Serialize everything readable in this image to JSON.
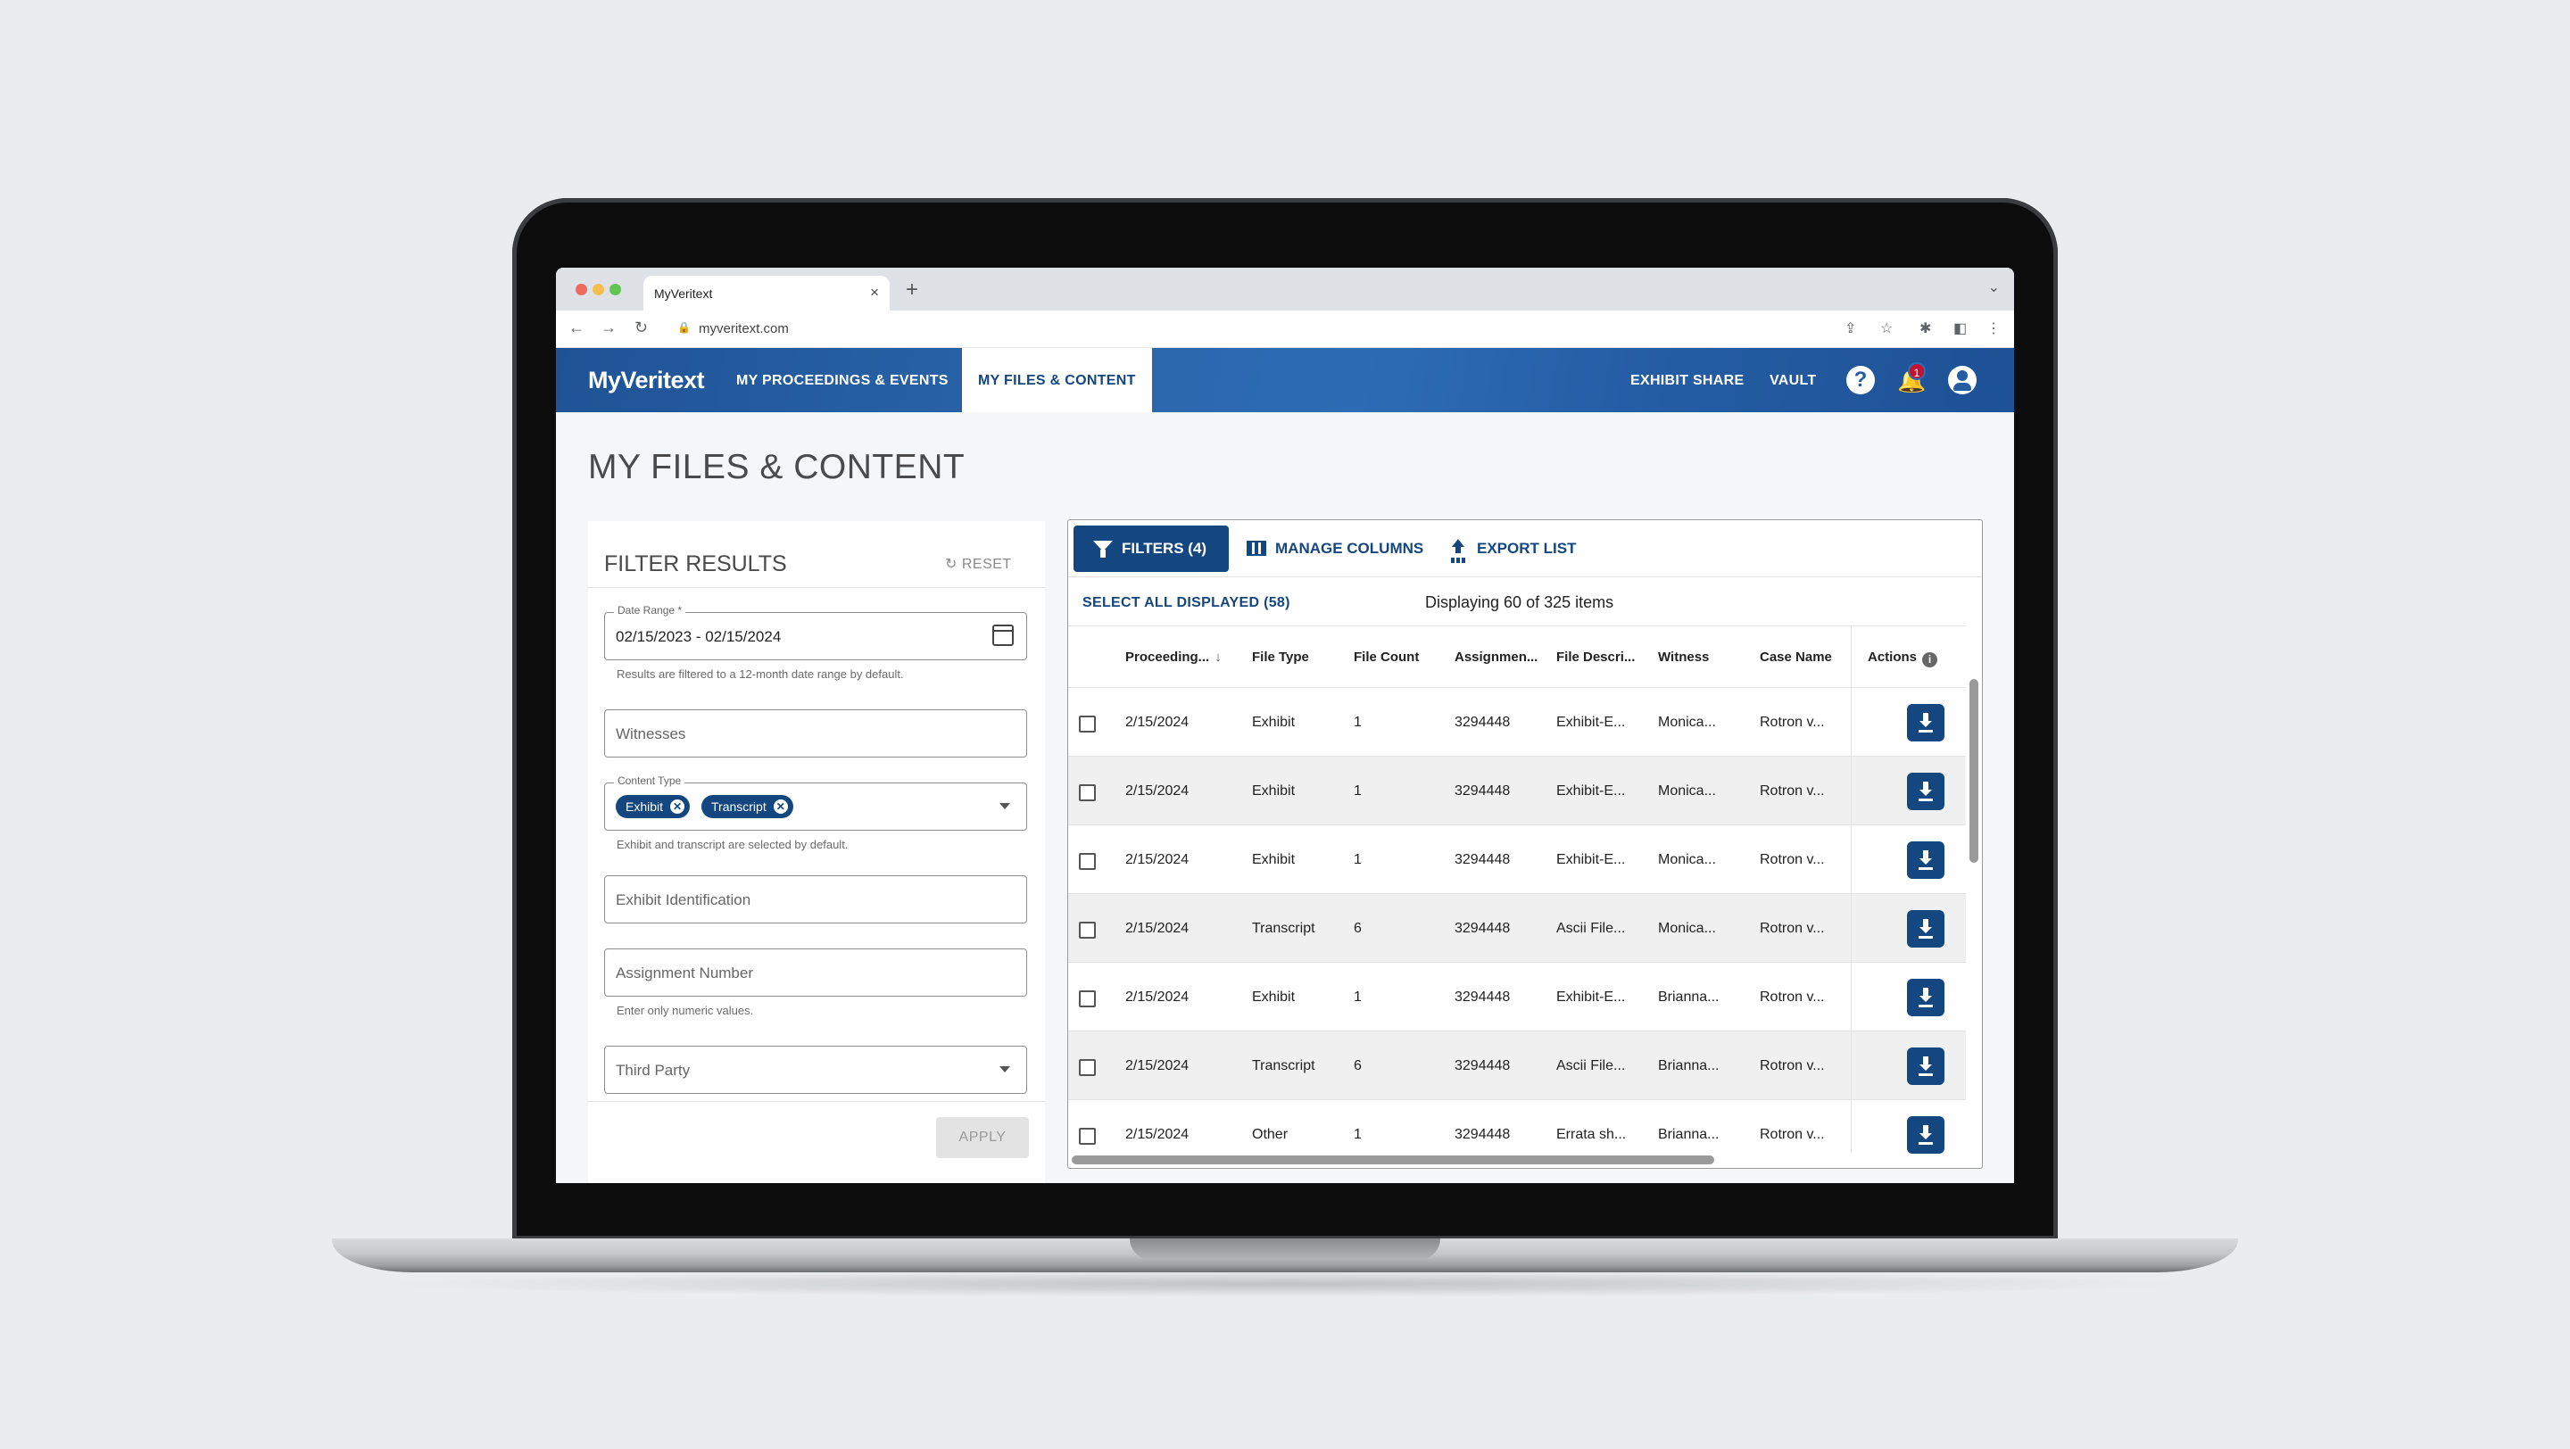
{
  "browser": {
    "tab_title": "MyVeritext",
    "tab_close": "×",
    "new_tab": "+",
    "url": "myveritext.com"
  },
  "header": {
    "brand": "MyVeritext",
    "nav": [
      "MY PROCEEDINGS & EVENTS",
      "MY FILES & CONTENT"
    ],
    "active_nav": "MY FILES & CONTENT",
    "right_links": [
      "EXHIBIT SHARE",
      "VAULT"
    ],
    "help": "?",
    "notification_count": "1"
  },
  "page": {
    "title": "MY FILES & CONTENT"
  },
  "filters": {
    "title": "FILTER RESULTS",
    "reset": "RESET",
    "date_range": {
      "label": "Date Range",
      "required_mark": "*",
      "value": "02/15/2023 - 02/15/2024",
      "help": "Results are filtered to a 12-month date range by default."
    },
    "witnesses": {
      "placeholder": "Witnesses"
    },
    "content_type": {
      "label": "Content Type",
      "chips": [
        "Exhibit",
        "Transcript"
      ],
      "chip_remove": "⊗",
      "help": "Exhibit and transcript are selected by default."
    },
    "exhibit_identification": {
      "placeholder": "Exhibit Identification"
    },
    "assignment_number": {
      "placeholder": "Assignment Number",
      "help": "Enter only numeric values."
    },
    "third_party": {
      "placeholder": "Third Party"
    },
    "apply": "APPLY"
  },
  "results": {
    "filters_button": "FILTERS (4)",
    "manage_columns": "MANAGE COLUMNS",
    "export_list": "EXPORT LIST",
    "select_all": "SELECT ALL DISPLAYED (58)",
    "displaying": "Displaying 60 of 325 items",
    "columns": [
      "Proceeding...",
      "File Type",
      "File Count",
      "Assignmen...",
      "File Descri...",
      "Witness",
      "Case Name",
      "Actions"
    ],
    "sort_indicator": "↓",
    "info_icon": "i",
    "rows": [
      [
        "2/15/2024",
        "Exhibit",
        "1",
        "3294448",
        "Exhibit-E...",
        "Monica...",
        "Rotron v..."
      ],
      [
        "2/15/2024",
        "Exhibit",
        "1",
        "3294448",
        "Exhibit-E...",
        "Monica...",
        "Rotron v..."
      ],
      [
        "2/15/2024",
        "Exhibit",
        "1",
        "3294448",
        "Exhibit-E...",
        "Monica...",
        "Rotron v..."
      ],
      [
        "2/15/2024",
        "Transcript",
        "6",
        "3294448",
        "Ascii File...",
        "Monica...",
        "Rotron v..."
      ],
      [
        "2/15/2024",
        "Exhibit",
        "1",
        "3294448",
        "Exhibit-E...",
        "Brianna...",
        "Rotron v..."
      ],
      [
        "2/15/2024",
        "Transcript",
        "6",
        "3294448",
        "Ascii File...",
        "Brianna...",
        "Rotron v..."
      ],
      [
        "2/15/2024",
        "Other",
        "1",
        "3294448",
        "Errata sh...",
        "Brianna...",
        "Rotron v..."
      ]
    ]
  },
  "colors": {
    "brand_blue": "#14467f",
    "header_blue": "#2a65aa",
    "badge_red": "#c8102e"
  }
}
